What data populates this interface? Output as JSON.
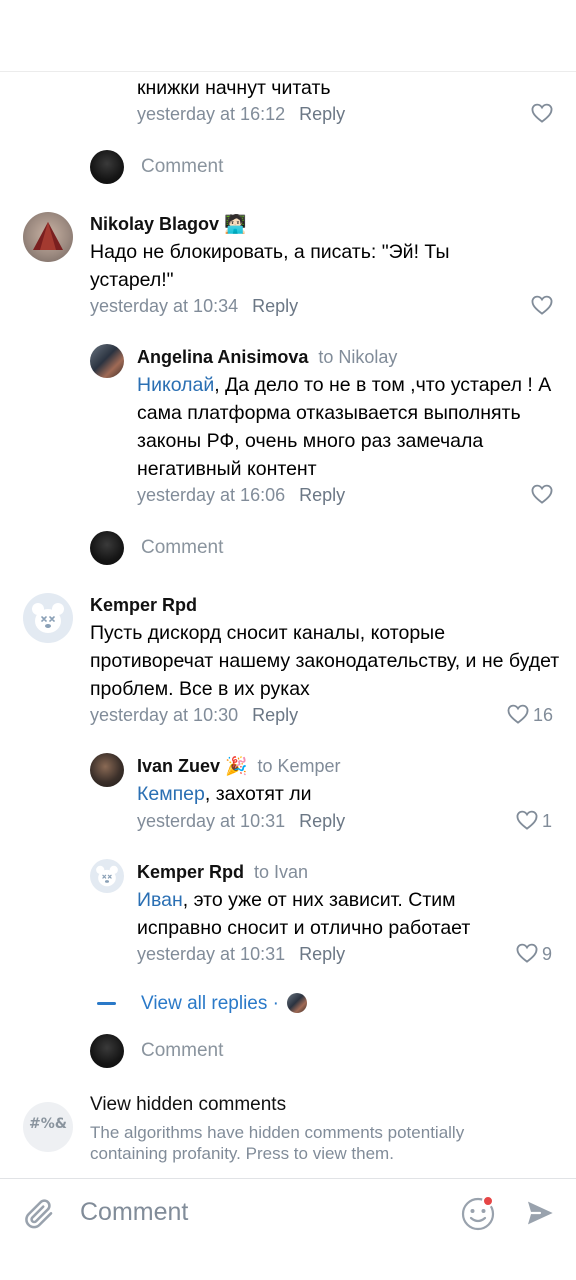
{
  "c0": {
    "text_tail": "книжки начнут читать",
    "time": "yesterday at 16:12",
    "reply": "Reply"
  },
  "comment_box_1": {
    "placeholder": "Comment"
  },
  "c1": {
    "author": "Nikolay Blagov",
    "author_emoji": "🧑🏻‍💻",
    "text": "Надо не блокировать, а писать: \"Эй! Ты устарел!\"",
    "time": "yesterday at 10:34",
    "reply": "Reply"
  },
  "c1r1": {
    "author": "Angelina Anisimova",
    "to": "to Nikolay",
    "mention": "Николай",
    "text": ", Да дело то не в том ,что устарел ! А сама платформа отказывается выполнять законы РФ, очень много раз замечала негативный контент",
    "time": "yesterday at 16:06",
    "reply": "Reply"
  },
  "comment_box_2": {
    "placeholder": "Comment"
  },
  "c2": {
    "author": "Kemper Rpd",
    "text": "Пусть дискорд сносит каналы, которые противоречат нашему законодательству, и не будет проблем. Все в их руках",
    "time": "yesterday at 10:30",
    "reply": "Reply",
    "likes": "16"
  },
  "c2r1": {
    "author": "Ivan Zuev",
    "author_emoji": "🎉",
    "to": "to Kemper",
    "mention": "Кемпер",
    "text": ", захотят ли",
    "time": "yesterday at 10:31",
    "reply": "Reply",
    "likes": "1"
  },
  "c2r2": {
    "author": "Kemper Rpd",
    "to": "to Ivan",
    "mention": "Иван",
    "text": ", это уже от них зависит. Стим исправно сносит и отлично работает",
    "time": "yesterday at 10:31",
    "reply": "Reply",
    "likes": "9"
  },
  "view_all": {
    "label": "View all replies ·"
  },
  "comment_box_3": {
    "placeholder": "Comment"
  },
  "hidden": {
    "icon_text": "#%&",
    "title": "View hidden comments",
    "subtitle": "The algorithms have hidden comments potentially containing profanity. Press to view them."
  },
  "bottom_bar": {
    "placeholder": "Comment"
  },
  "colors": {
    "accent": "#2a79c8",
    "mention": "#2a6fb3",
    "meta": "#818c99",
    "notification_dot": "#e64646"
  }
}
